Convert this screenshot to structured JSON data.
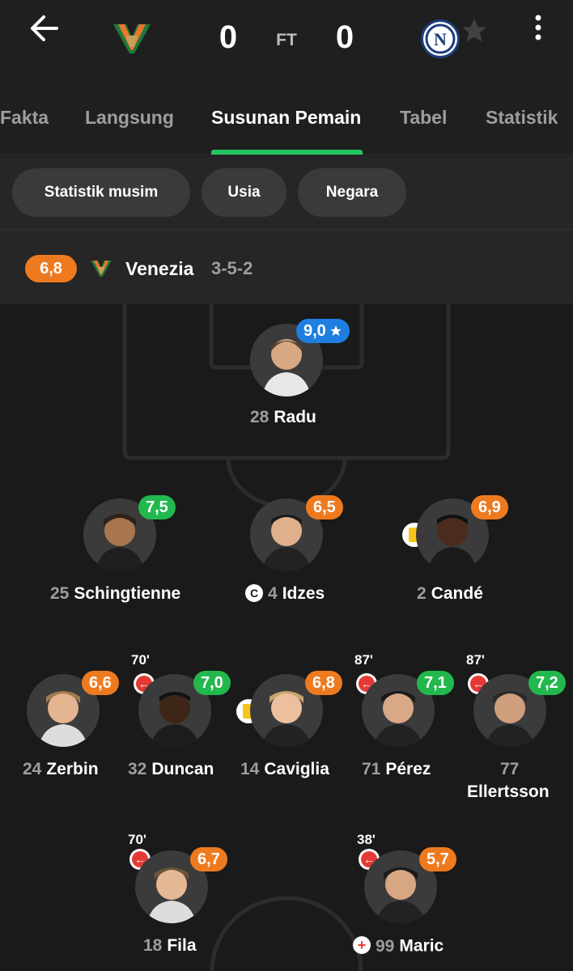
{
  "match": {
    "home_score": "0",
    "status": "FT",
    "away_score": "0"
  },
  "tabs": [
    "Fakta",
    "Langsung",
    "Susunan Pemain",
    "Tabel",
    "Statistik"
  ],
  "chips": [
    "Statistik musim",
    "Usia",
    "Negara"
  ],
  "team": {
    "rating": "6,8",
    "name": "Venezia",
    "formation": "3-5-2"
  },
  "players": [
    {
      "num": "28",
      "name": "Radu",
      "rating": "9,0",
      "color": "blue",
      "star": true
    },
    {
      "num": "25",
      "name": "Schingtienne",
      "rating": "7,5",
      "color": "green"
    },
    {
      "num": "4",
      "name": "Idzes",
      "rating": "6,5",
      "color": "orange",
      "captain": "C"
    },
    {
      "num": "2",
      "name": "Candé",
      "rating": "6,9",
      "color": "orange",
      "yellow": true
    },
    {
      "num": "24",
      "name": "Zerbin",
      "rating": "6,6",
      "color": "orange"
    },
    {
      "num": "32",
      "name": "Duncan",
      "rating": "7,0",
      "color": "green",
      "sub": "70'"
    },
    {
      "num": "14",
      "name": "Caviglia",
      "rating": "6,8",
      "color": "orange",
      "yellow": true
    },
    {
      "num": "71",
      "name": "Pérez",
      "rating": "7,1",
      "color": "green",
      "sub": "87'"
    },
    {
      "num": "77",
      "name": "Ellertsson",
      "rating": "7,2",
      "color": "green",
      "sub": "87'"
    },
    {
      "num": "18",
      "name": "Fila",
      "rating": "6,7",
      "color": "orange",
      "sub": "70'"
    },
    {
      "num": "99",
      "name": "Maric",
      "rating": "5,7",
      "color": "orange",
      "sub": "38'",
      "injury": true
    }
  ],
  "colors": {
    "accent": "#22c55e",
    "rating_orange": "#ee7a1f",
    "rating_green": "#22b84e",
    "rating_blue": "#1f7fe0"
  },
  "icons": [
    "back-arrow-icon",
    "more-vertical-icon",
    "substitution-icon",
    "yellow-card-icon",
    "captain-icon",
    "injury-icon",
    "star-icon"
  ]
}
